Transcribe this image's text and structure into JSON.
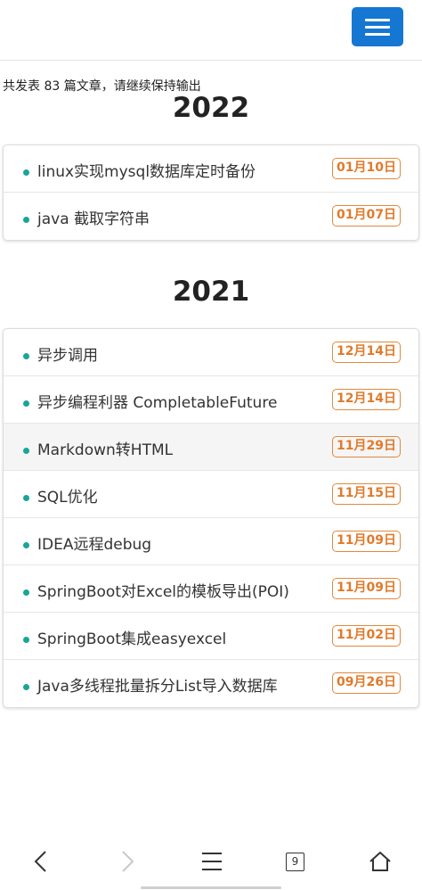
{
  "summary": "共发表 83 篇文章，请继续保持输出",
  "years": [
    {
      "year": "2022",
      "posts": [
        {
          "title": "linux实现mysql数据库定时备份",
          "date": "01月10日"
        },
        {
          "title": "java 截取字符串",
          "date": "01月07日"
        }
      ]
    },
    {
      "year": "2021",
      "posts": [
        {
          "title": "异步调用",
          "date": "12月14日"
        },
        {
          "title": "异步编程利器 CompletableFuture",
          "date": "12月14日"
        },
        {
          "title": "Markdown转HTML",
          "date": "11月29日"
        },
        {
          "title": "SQL优化",
          "date": "11月15日"
        },
        {
          "title": "IDEA远程debug",
          "date": "11月09日"
        },
        {
          "title": "SpringBoot对Excel的模板导出(POI)",
          "date": "11月09日"
        },
        {
          "title": "SpringBoot集成easyexcel",
          "date": "11月02日"
        },
        {
          "title": "Java多线程批量拆分List导入数据库",
          "date": "09月26日"
        }
      ]
    }
  ],
  "bottom_nav": {
    "tab_count": "9",
    "icons": [
      "back-icon",
      "forward-icon",
      "menu-icon",
      "tabs-icon",
      "home-icon"
    ]
  },
  "colors": {
    "menu_button": "#1677d2",
    "dot": "#1aa596",
    "badge": "#e07a2a"
  }
}
